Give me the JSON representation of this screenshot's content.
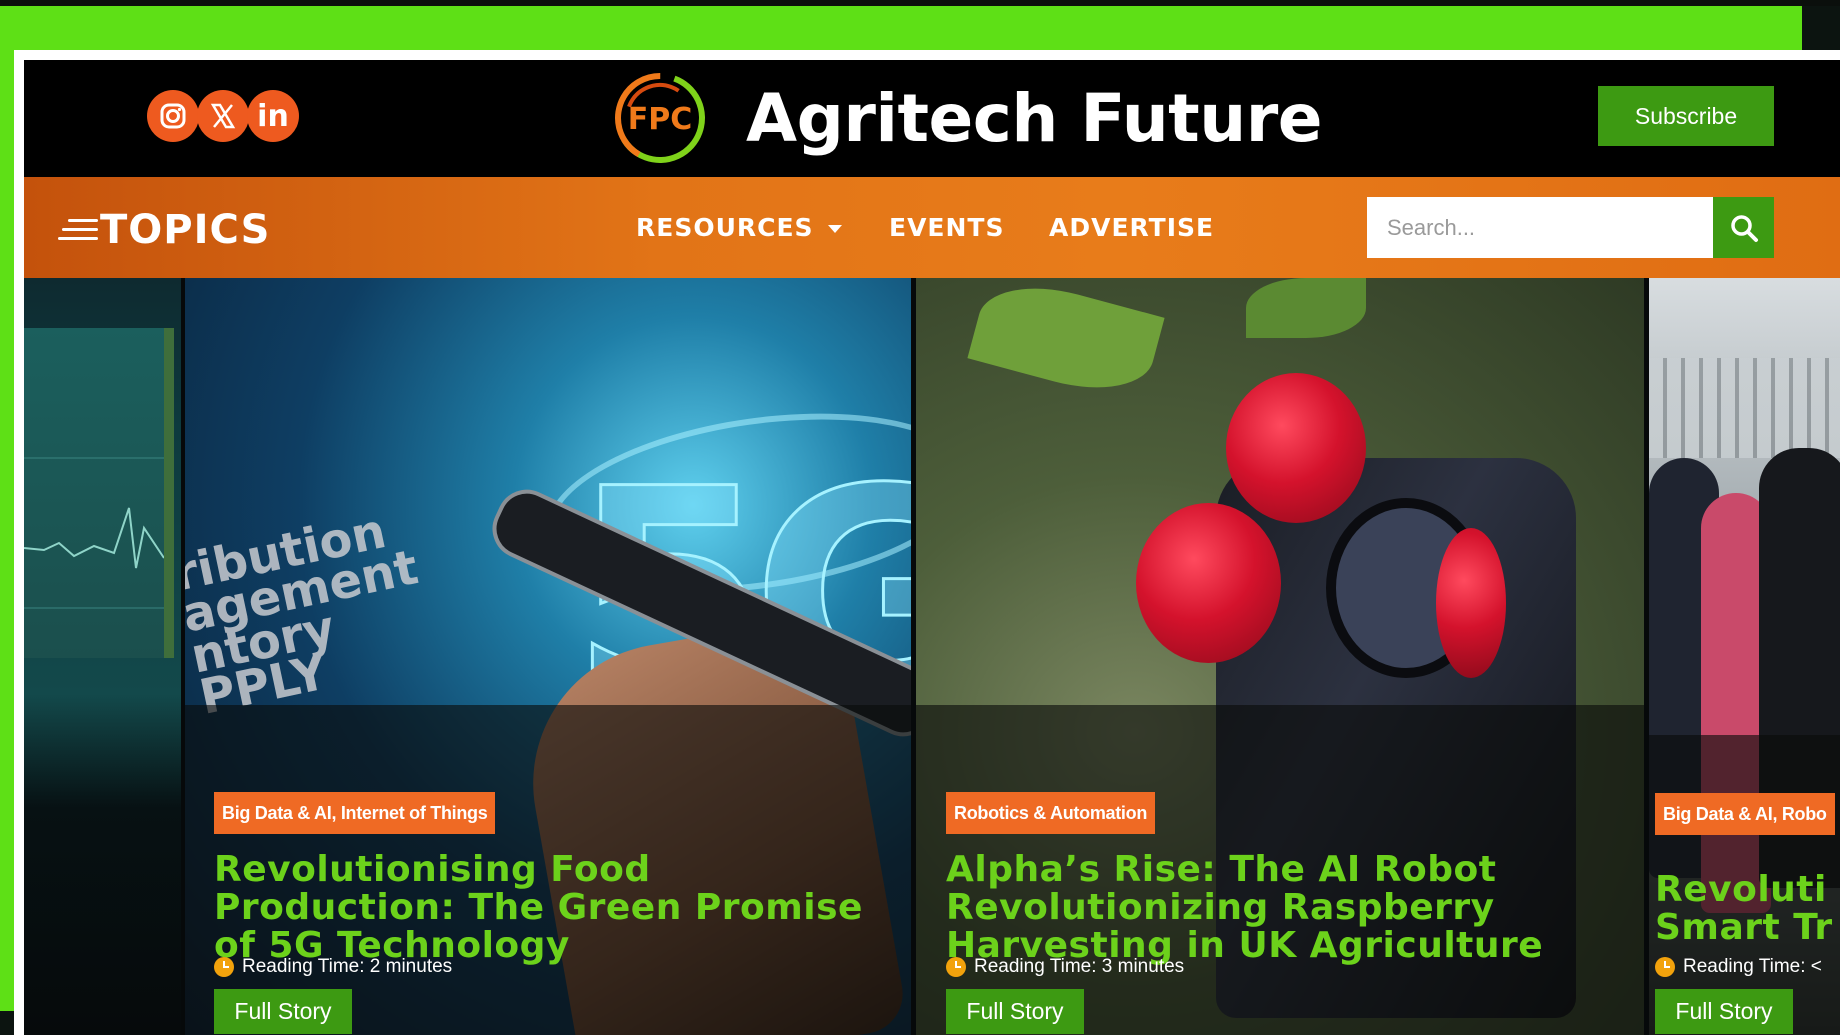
{
  "site": {
    "brand_name": "Agritech Future",
    "logo_text": "FPC",
    "subscribe_label": "Subscribe"
  },
  "social": [
    {
      "icon": "instagram-icon"
    },
    {
      "icon": "x-icon"
    },
    {
      "icon": "linkedin-icon",
      "text": "in"
    }
  ],
  "nav": {
    "topics_label": "TOPICS",
    "resources_label": "RESOURCES",
    "events_label": "EVENTS",
    "advertise_label": "ADVERTISE"
  },
  "search": {
    "placeholder": "Search..."
  },
  "cards": [
    {
      "tag": "Big Data & AI, Internet of Things",
      "title": "Revolutionising Food Production: The Green Promise of 5G Technology",
      "reading_time": "Reading Time: 2 minutes",
      "button": "Full Story"
    },
    {
      "tag": "Robotics & Automation",
      "title": "Alpha’s Rise: The AI Robot Revolutionizing Raspberry Harvesting in UK Agriculture",
      "reading_time": "Reading Time: 3 minutes",
      "button": "Full Story"
    },
    {
      "tag": "Big Data & AI, Robo",
      "title": "Revoluti Smart Tr",
      "reading_time": "Reading Time: <",
      "button": "Full Story"
    }
  ],
  "colors": {
    "frame_green": "#5ee016",
    "nav_orange": "#e27417",
    "button_green": "#3d9a12",
    "title_green": "#6cd21b",
    "tag_orange": "#ef6a24",
    "social_orange": "#ee5a1f"
  }
}
